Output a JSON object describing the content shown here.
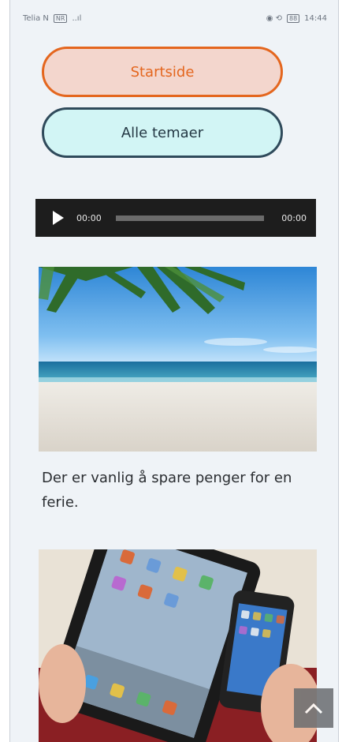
{
  "statusbar": {
    "carrier": "Telia N",
    "carrier_badge": "NR",
    "signal": "..ıl",
    "icons_right": "◉ ⟲",
    "battery": "88",
    "time": "14:44"
  },
  "nav": {
    "home_label": "Startside",
    "topics_label": "Alle temaer"
  },
  "audio": {
    "current_time": "00:00",
    "duration": "00:00",
    "progress": 0
  },
  "content": {
    "caption": "Der er vanlig å spare penger for en ferie."
  },
  "colors": {
    "home_border": "#e4661e",
    "home_fill": "#f3d6cd",
    "topics_border": "#2f4a5b",
    "topics_fill": "#d2f5f5",
    "page_bg": "#eff3f7"
  },
  "icons": {
    "play": "play-icon",
    "back_to_top": "chevron-up-icon"
  }
}
